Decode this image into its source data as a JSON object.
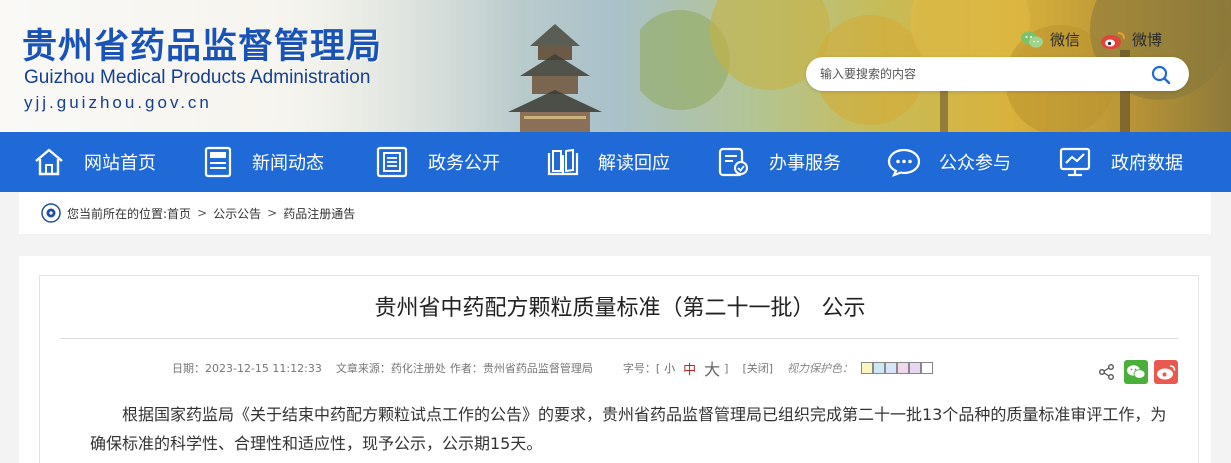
{
  "header": {
    "title": "贵州省药品监督管理局",
    "subtitle_en": "Guizhou Medical Products Administration",
    "url": "yjj.guizhou.gov.cn",
    "wechat_label": "微信",
    "weibo_label": "微博",
    "search_placeholder": "输入要搜索的内容",
    "wechat_color": "#7cc26b",
    "weibo_color": "#e0453b"
  },
  "nav": {
    "items": [
      {
        "label": "网站首页",
        "icon": "home-icon"
      },
      {
        "label": "新闻动态",
        "icon": "news-icon"
      },
      {
        "label": "政务公开",
        "icon": "document-icon"
      },
      {
        "label": "解读回应",
        "icon": "book-icon"
      },
      {
        "label": "办事服务",
        "icon": "service-icon"
      },
      {
        "label": "公众参与",
        "icon": "chat-icon"
      },
      {
        "label": "政府数据",
        "icon": "chart-icon"
      }
    ],
    "bg_color": "#1f6ad6"
  },
  "breadcrumb": {
    "prefix": "您当前所在的位置:",
    "items": [
      "首页",
      "公示公告",
      "药品注册通告"
    ],
    "separator": ">"
  },
  "article": {
    "title": "贵州省中药配方颗粒质量标准（第二十一批） 公示",
    "date": "日期：2023-12-15 11:12:33",
    "source": "文章来源：药化注册处",
    "author": "作者：贵州省药品监督管理局",
    "font_size_label": "字号：[",
    "font_small": "小",
    "font_medium": "中",
    "font_large": "大",
    "font_close_bracket": "]",
    "close_label": "[关闭]",
    "eye_label": "视力保护色：",
    "swatch_colors": [
      "#faf4c0",
      "#cce8f5",
      "#d5e4f7",
      "#f0d8ec",
      "#e7d7f5",
      "#ffffff"
    ],
    "body": "根据国家药监局《关于结束中药配方颗粒试点工作的公告》的要求，贵州省药品监督管理局已组织完成第二十一批13个品种的质量标准审评工作，为确保标准的科学性、合理性和适应性，现予公示，公示期15天。"
  }
}
